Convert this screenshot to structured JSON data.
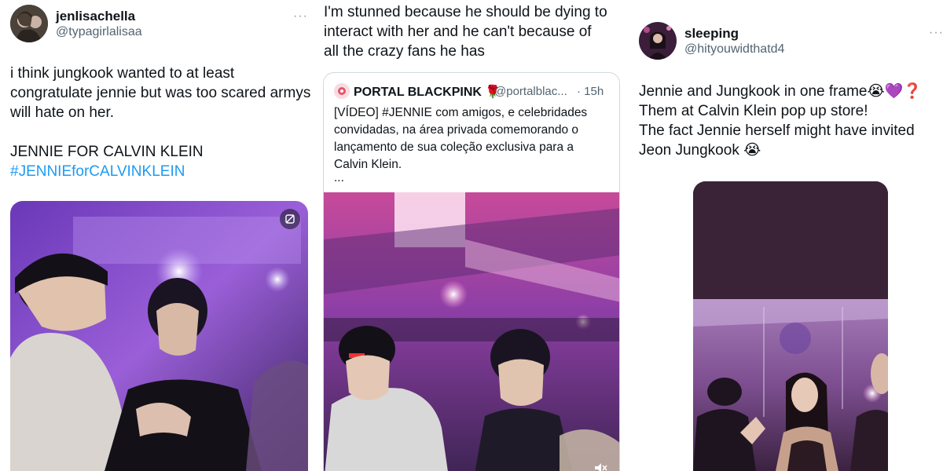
{
  "post1": {
    "display_name": "jenlisachella",
    "handle": "@typagirlalisaa",
    "more_label": "···",
    "text_line1": "i think jungkook wanted to at least",
    "text_line2": "congratulate jennie but was too scared armys",
    "text_line3": "will hate on her.",
    "text_line4": "JENNIE FOR CALVIN KLEIN",
    "hashtag": "#JENNIEforCALVINKLEIN"
  },
  "post2": {
    "text_line1": "I'm stunned because he should be dying to",
    "text_line2": "interact with her and he can't because of",
    "text_line3": "all the crazy fans he has",
    "quote": {
      "display_name": "PORTAL BLACKPINK 🌹",
      "handle": "@portalblac...",
      "time": "· 15h",
      "text_line1": "[VÍDEO] #JENNIE com amigos, e celebridades",
      "text_line2": "convidadas, na área privada comemorando o",
      "text_line3": "lançamento de sua coleção exclusiva para a",
      "text_line4": "Calvin Klein.",
      "ellipsis": "..."
    }
  },
  "post3": {
    "display_name": "sleeping",
    "handle": "@hityouwidthatd4",
    "more_label": "···",
    "text_line1": "Jennie and Jungkook in one frame😭💜❓",
    "text_line2": "Them at Calvin Klein pop up store!",
    "text_line3": "The fact Jennie herself might have invited",
    "text_line4": "Jeon Jungkook 😭"
  },
  "icons": {
    "media_badge": "media-tag-icon",
    "mute": "mute-icon"
  },
  "colors": {
    "hashtag": "#1d9bf0",
    "club_purple": "#8a3fd1",
    "club_pink": "#e24fa9"
  }
}
